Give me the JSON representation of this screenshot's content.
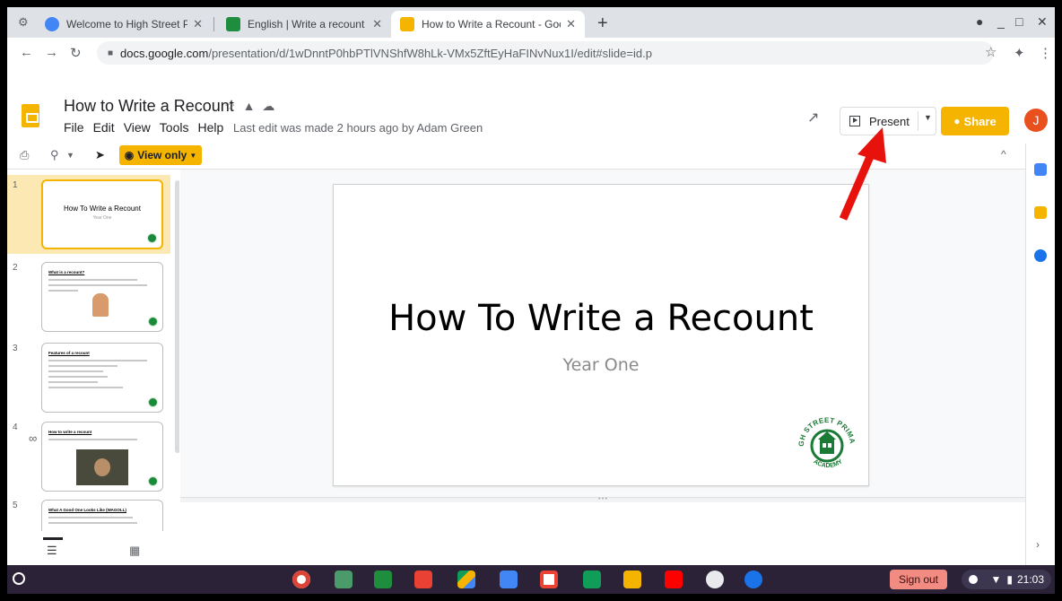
{
  "browser": {
    "tabs": [
      {
        "title": "Welcome to High Street Primary",
        "favicon_color": "#4285f4"
      },
      {
        "title": "English | Write a recount of your",
        "favicon_color": "#1e8e3e"
      },
      {
        "title": "How to Write a Recount - Google",
        "favicon_color": "#f4b400"
      }
    ],
    "url_host": "docs.google.com",
    "url_path": "/presentation/d/1wDnntP0hbPTlVNShfW8hLk-VMx5ZftEyHaFINvNux1I/edit#slide=id.p"
  },
  "app": {
    "doc_title": "How to Write a Recount",
    "menus": [
      "File",
      "Edit",
      "View",
      "Tools",
      "Help"
    ],
    "last_edit": "Last edit was made 2 hours ago by Adam Green",
    "present_label": "Present",
    "share_label": "Share",
    "avatar_letter": "J",
    "view_only_label": "View only",
    "accent": "#f4b400"
  },
  "filmstrip": [
    {
      "num": "1",
      "title": "How To Write a Recount",
      "subtitle": "Year One",
      "heading": ""
    },
    {
      "num": "2",
      "title": "",
      "subtitle": "",
      "heading": "What is a recount?"
    },
    {
      "num": "3",
      "title": "",
      "subtitle": "",
      "heading": "Features of a recount"
    },
    {
      "num": "4",
      "title": "",
      "subtitle": "",
      "heading": "How to write a recount"
    },
    {
      "num": "5",
      "title": "",
      "subtitle": "",
      "heading": "What A Good One Looks Like (WAGOLL)"
    }
  ],
  "slide": {
    "title": "How To Write a Recount",
    "subtitle": "Year One",
    "logo_text_top": "HIGH STREET PRIMARY",
    "logo_text_bottom": "ACADEMY"
  },
  "shelf": {
    "signout_label": "Sign out",
    "time": "21:03"
  }
}
